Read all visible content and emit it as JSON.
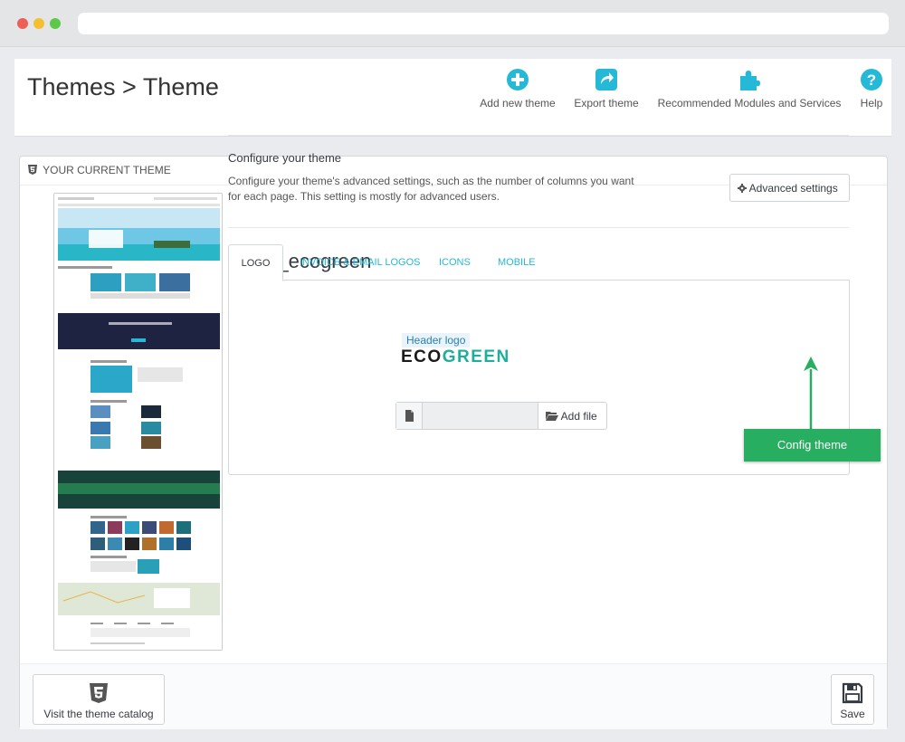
{
  "page": {
    "title": "Themes > Theme"
  },
  "toolbar": {
    "add_new_theme": "Add new theme",
    "export_theme": "Export theme",
    "recommended": "Recommended Modules and Services",
    "help": "Help"
  },
  "panel": {
    "heading": "YOUR CURRENT THEME",
    "theme_name": "leo_ecogreen",
    "configure_title": "Configure your theme",
    "configure_desc": "Configure your theme's advanced settings, such as the number of columns you want for each page. This setting is mostly for advanced users.",
    "advanced_button": "Advanced settings",
    "tabs": [
      "LOGO",
      "INVOICE & EMAIL LOGOS",
      "ICONS",
      "MOBILE"
    ],
    "header_logo_label": "Header logo",
    "logo_text_dark": "ECO",
    "logo_text_green": "GREEN",
    "add_file": "Add file",
    "catalog_button": "Visit the theme catalog",
    "save_button": "Save"
  },
  "callout": {
    "label": "Config theme"
  },
  "colors": {
    "accent": "#25b9d7",
    "callout": "#27ae60",
    "logo_green": "#1fae9b"
  },
  "icons": [
    "plus-circle-icon",
    "export-icon",
    "puzzle-icon",
    "help-icon",
    "html5-icon",
    "gear-icon",
    "file-icon",
    "folder-open-icon",
    "save-icon"
  ]
}
